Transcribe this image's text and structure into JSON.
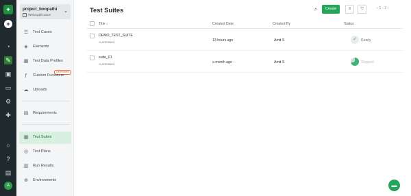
{
  "project": {
    "name": "project_boopathi",
    "type": "WebApplication"
  },
  "sidebar": {
    "items": [
      {
        "label": "Test Cases",
        "icon": "test-cases-icon"
      },
      {
        "label": "Elements",
        "icon": "elements-icon"
      },
      {
        "label": "Test Data Profiles",
        "icon": "test-data-icon"
      },
      {
        "label": "Custom Functions",
        "icon": "custom-functions-icon",
        "badge": "Deprecated"
      },
      {
        "label": "Uploads",
        "icon": "uploads-icon"
      },
      {
        "label": "Requirements",
        "icon": "requirements-icon"
      },
      {
        "label": "Test Suites",
        "icon": "test-suites-icon"
      },
      {
        "label": "Test Plans",
        "icon": "test-plans-icon"
      },
      {
        "label": "Run Results",
        "icon": "run-results-icon"
      },
      {
        "label": "Environments",
        "icon": "environments-icon"
      }
    ],
    "active": "Test Suites"
  },
  "header": {
    "title": "Test Suites",
    "create_label": "Create",
    "pager": "1 - 2"
  },
  "table": {
    "columns": {
      "title": "Title ↓",
      "created_date": "Created Date",
      "created_by": "Created By",
      "status": "Status"
    },
    "rows": [
      {
        "title": "DEMO_TEST_SUITE",
        "type": "Automated",
        "created_date": "13 hours ago",
        "created_by": "Amit S",
        "status": "Ready"
      },
      {
        "title": "suite_01",
        "type": "Automated",
        "created_date": "a month ago",
        "created_by": "Amit S",
        "status": "Stopped"
      }
    ]
  },
  "user": {
    "avatar_initial": "A"
  },
  "colors": {
    "accent": "#23a55a",
    "rail": "#1f2a2e",
    "active_bg": "#d7f0df",
    "badge": "#e8632b"
  }
}
